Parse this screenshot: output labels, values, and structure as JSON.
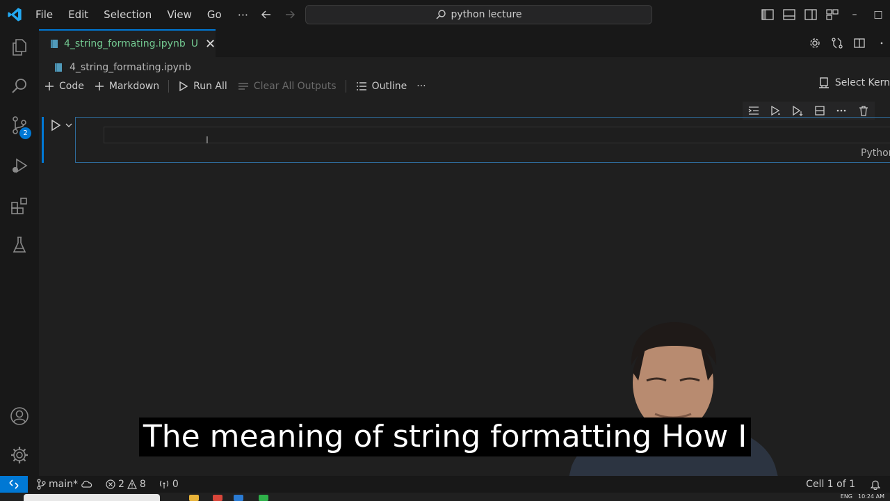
{
  "titlebar": {
    "menu": [
      "File",
      "Edit",
      "Selection",
      "View",
      "Go"
    ],
    "more": "···",
    "search_text": "python lecture",
    "minimize": "–",
    "restore": "□"
  },
  "activity": {
    "scm_badge": "2"
  },
  "tab": {
    "label": "4_string_formating.ipynb",
    "status": "U",
    "close": "✕"
  },
  "breadcrumb": {
    "file": "4_string_formating.ipynb"
  },
  "notebook_toolbar": {
    "code": "Code",
    "markdown": "Markdown",
    "run_all": "Run All",
    "clear_outputs": "Clear All Outputs",
    "outline": "Outline",
    "more": "···",
    "select_kernel": "Select Kern"
  },
  "cell": {
    "language": "Python",
    "cursor": "I"
  },
  "caption": {
    "text": "The meaning of string formatting How I"
  },
  "statusbar": {
    "branch": "main*",
    "errors": "2",
    "warnings": "8",
    "ports": "0",
    "cell_position": "Cell 1 of 1"
  },
  "taskbar": {
    "lang": "ENG",
    "time": "10:24 AM"
  },
  "colors": {
    "accent": "#0078d4",
    "modified": "#73c991",
    "background": "#1f1f1f"
  }
}
